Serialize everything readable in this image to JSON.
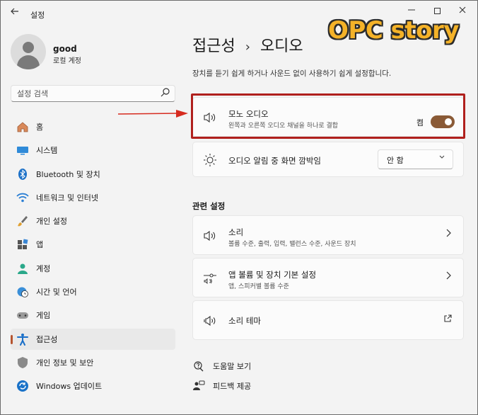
{
  "window": {
    "title": "설정",
    "back_icon": "back-arrow-icon",
    "minimize_icon": "minimize-icon",
    "maximize_icon": "maximize-icon",
    "close_icon": "close-icon"
  },
  "user": {
    "name": "good",
    "account_type": "로컬 계정"
  },
  "search": {
    "placeholder": "설정 검색",
    "icon": "search-icon"
  },
  "sidebar": {
    "items": [
      {
        "label": "홈",
        "icon": "home-icon",
        "active": false
      },
      {
        "label": "시스템",
        "icon": "monitor-icon",
        "active": false
      },
      {
        "label": "Bluetooth 및 장치",
        "icon": "bluetooth-icon",
        "active": false
      },
      {
        "label": "네트워크 및 인터넷",
        "icon": "wifi-icon",
        "active": false
      },
      {
        "label": "개인 설정",
        "icon": "brush-icon",
        "active": false
      },
      {
        "label": "앱",
        "icon": "apps-icon",
        "active": false
      },
      {
        "label": "계정",
        "icon": "person-icon",
        "active": false
      },
      {
        "label": "시간 및 언어",
        "icon": "globe-clock-icon",
        "active": false
      },
      {
        "label": "게임",
        "icon": "gamepad-icon",
        "active": false
      },
      {
        "label": "접근성",
        "icon": "accessibility-icon",
        "active": true
      },
      {
        "label": "개인 정보 및 보안",
        "icon": "shield-icon",
        "active": false
      },
      {
        "label": "Windows 업데이트",
        "icon": "update-icon",
        "active": false
      }
    ]
  },
  "main": {
    "breadcrumb_parent": "접근성",
    "breadcrumb_separator": "›",
    "breadcrumb_current": "오디오",
    "description": "장치를 듣기 쉽게 하거나 사운드 없이 사용하기 쉽게 설정합니다.",
    "mono_audio": {
      "title": "모노 오디오",
      "subtitle": "왼쪽과 오른쪽 오디오 채널을 하나로 결합",
      "toggle_label": "켬",
      "toggle_on": true,
      "icon": "speaker-icon"
    },
    "flash_screen": {
      "title": "오디오 알림 중 화면 깜박임",
      "dropdown_value": "안 함",
      "icon": "brightness-icon"
    },
    "related_title": "관련 설정",
    "related": [
      {
        "title": "소리",
        "subtitle": "볼륨 수준, 출력, 입력, 밸런스 수준, 사운드 장치",
        "icon": "speaker-icon",
        "action": "chevron"
      },
      {
        "title": "앱 볼륨 및 장치 기본 설정",
        "subtitle": "앱, 스피커별 볼륨 수준",
        "icon": "mixer-icon",
        "action": "chevron"
      },
      {
        "title": "소리 테마",
        "subtitle": "",
        "icon": "sound-theme-icon",
        "action": "external"
      }
    ],
    "links": [
      {
        "label": "도움말 보기",
        "icon": "help-icon"
      },
      {
        "label": "피드백 제공",
        "icon": "feedback-icon"
      }
    ]
  },
  "overlay": {
    "watermark": "OPC story",
    "highlight_color": "#b0201d",
    "watermark_color": "#f4b228"
  },
  "colors": {
    "accent": "#8a5a36",
    "active_marker": "#b5542f",
    "background": "#f3f3f3",
    "card": "#fbfbfb"
  }
}
